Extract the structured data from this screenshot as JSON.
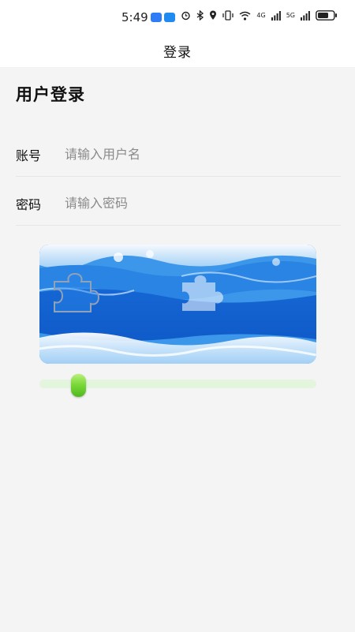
{
  "status_bar": {
    "time": "5:49",
    "network_4g": "4G",
    "network_5g": "5G",
    "app_icon_colors": [
      "#2f7df6",
      "#1f8bf0"
    ]
  },
  "app_bar": {
    "title": "登录"
  },
  "form": {
    "heading": "用户登录",
    "account": {
      "label": "账号",
      "placeholder": "请输入用户名",
      "value": ""
    },
    "password": {
      "label": "密码",
      "placeholder": "请输入密码",
      "value": ""
    }
  },
  "captcha": {
    "image": "ocean-wave-photo",
    "piece_icon": "puzzle-piece-icon",
    "slot_icon": "puzzle-slot-icon"
  },
  "slider": {
    "value": 0.12,
    "track_color": "#e4f5de",
    "thumb_color": "#7bd93a"
  }
}
